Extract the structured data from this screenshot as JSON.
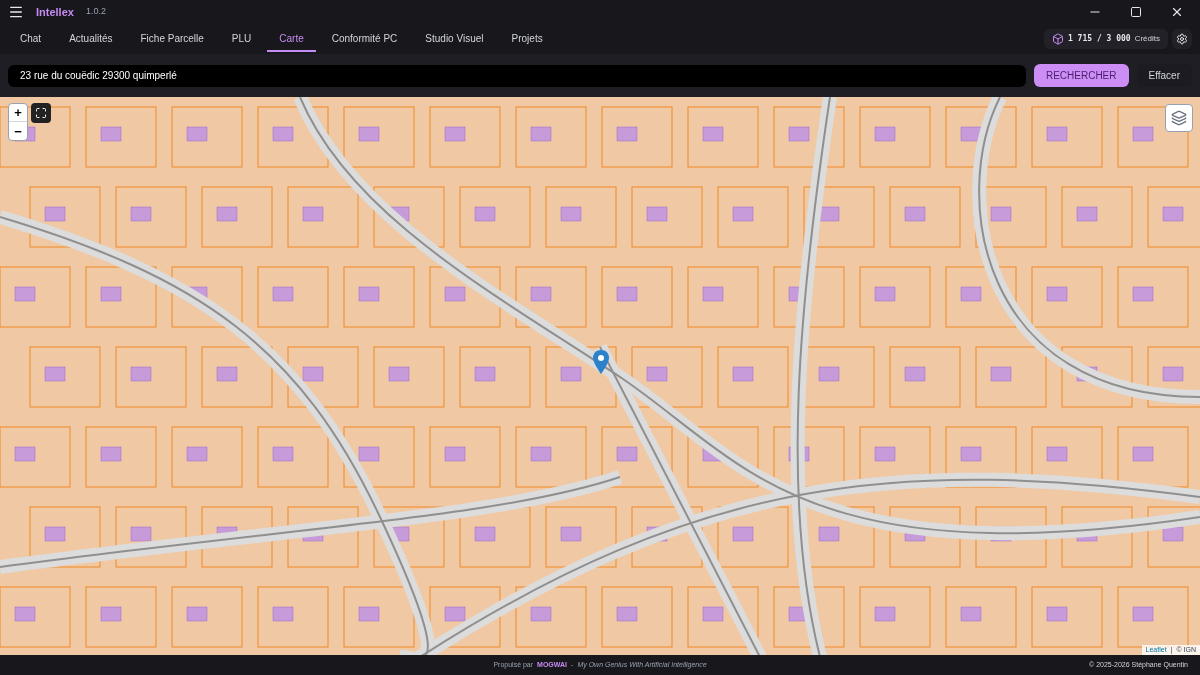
{
  "app": {
    "name": "Intellex",
    "version": "1.0.2"
  },
  "tabs": [
    {
      "label": "Chat",
      "selected": false
    },
    {
      "label": "Actualités",
      "selected": false
    },
    {
      "label": "Fiche Parcelle",
      "selected": false
    },
    {
      "label": "PLU",
      "selected": false
    },
    {
      "label": "Carte",
      "selected": true
    },
    {
      "label": "Conformité PC",
      "selected": false
    },
    {
      "label": "Studio Visuel",
      "selected": false
    },
    {
      "label": "Projets",
      "selected": false
    }
  ],
  "credits": {
    "used": "1 715",
    "separator": "/",
    "total": "3 000",
    "label": "Crédits"
  },
  "search": {
    "value": "23 rue du couëdic 29300 quimperlé",
    "submit": "RECHERCHER",
    "clear": "Effacer"
  },
  "map": {
    "zoom_in": "+",
    "zoom_out": "−",
    "attribution": {
      "link": "Leaflet",
      "separator": "|",
      "source": "© IGN"
    }
  },
  "footer": {
    "prefix": "Propulsé par",
    "brand": "MOGWAI",
    "dash": "-",
    "tagline": "My Own Genius With Artificial Intelligence",
    "copyright": "© 2025-2026 Stéphane Quentin"
  }
}
